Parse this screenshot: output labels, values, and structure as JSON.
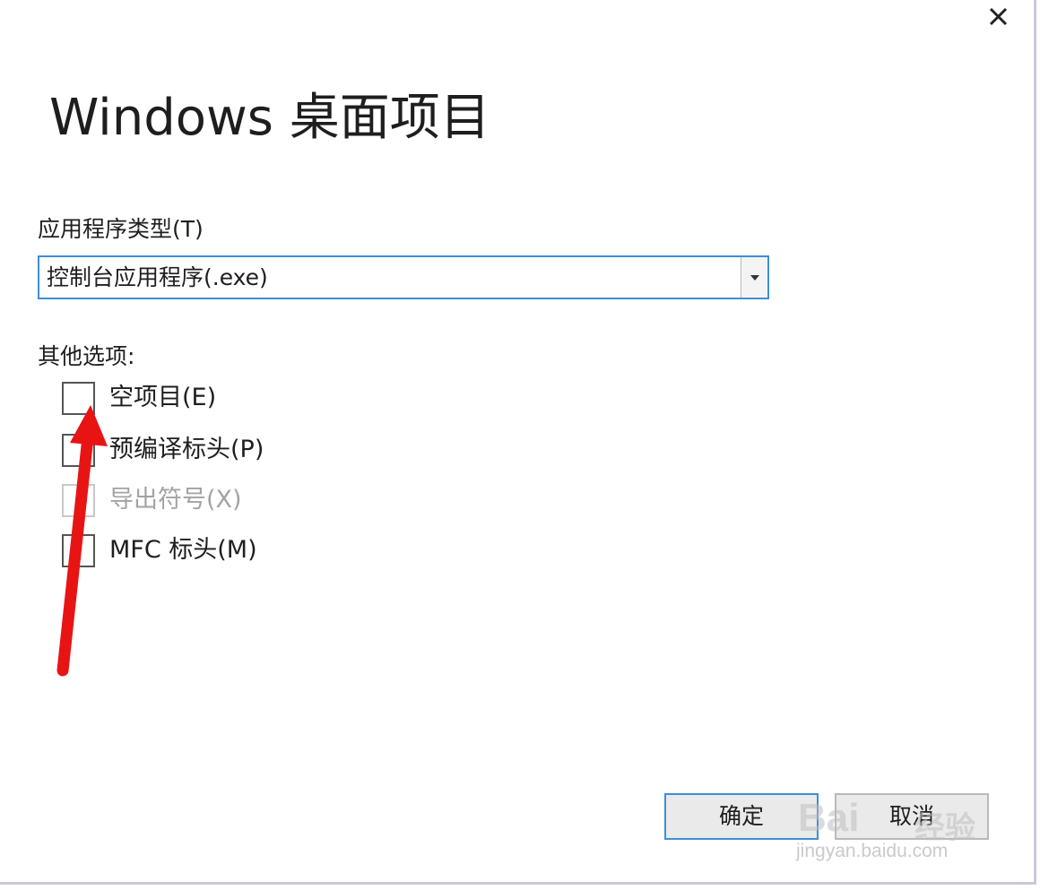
{
  "dialog": {
    "title": "Windows 桌面项目",
    "close_icon": "close-icon"
  },
  "app_type": {
    "label": "应用程序类型(T)",
    "selected": "控制台应用程序(.exe)"
  },
  "other_options": {
    "label": "其他选项:",
    "items": [
      {
        "label": "空项目(E)",
        "checked": false,
        "enabled": true
      },
      {
        "label": "预编译标头(P)",
        "checked": false,
        "enabled": true
      },
      {
        "label": "导出符号(X)",
        "checked": false,
        "enabled": false
      },
      {
        "label": "MFC 标头(M)",
        "checked": false,
        "enabled": true
      }
    ]
  },
  "buttons": {
    "ok": "确定",
    "cancel": "取消"
  },
  "annotation": {
    "arrow_color": "#e81414"
  },
  "watermark": {
    "brand": "Bai",
    "brand_cn": "经验",
    "url": "jingyan.baidu.com"
  },
  "colors": {
    "accent": "#3d8fd8",
    "text": "#1e1e1e",
    "disabled_text": "#a3a3a3"
  }
}
